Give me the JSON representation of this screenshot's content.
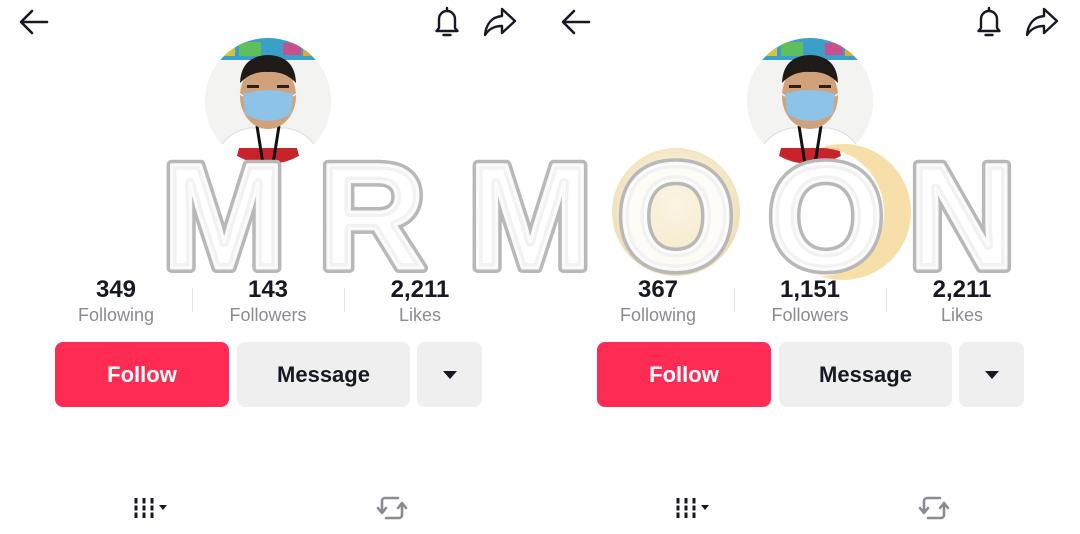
{
  "watermark": {
    "text": "MR MOON"
  },
  "panels": [
    {
      "id": "left",
      "stats": [
        {
          "value": "349",
          "label": "Following"
        },
        {
          "value": "143",
          "label": "Followers"
        },
        {
          "value": "2,211",
          "label": "Likes"
        }
      ],
      "actions": {
        "follow": "Follow",
        "message": "Message"
      },
      "icons": {
        "back": "arrow-left-icon",
        "notifications": "bell-icon",
        "share": "share-icon",
        "more": "caret-down-icon",
        "videos_tab": "grid-icon",
        "reposts_tab": "repost-icon"
      }
    },
    {
      "id": "right",
      "stats": [
        {
          "value": "367",
          "label": "Following"
        },
        {
          "value": "1,151",
          "label": "Followers"
        },
        {
          "value": "2,211",
          "label": "Likes"
        }
      ],
      "actions": {
        "follow": "Follow",
        "message": "Message"
      },
      "icons": {
        "back": "arrow-left-icon",
        "notifications": "bell-icon",
        "share": "share-icon",
        "more": "caret-down-icon",
        "videos_tab": "grid-icon",
        "reposts_tab": "repost-icon"
      }
    }
  ],
  "colors": {
    "accent": "#fe2c55",
    "button_bg": "#efeff0",
    "text_primary": "#161823",
    "text_secondary": "#8a8b91"
  }
}
